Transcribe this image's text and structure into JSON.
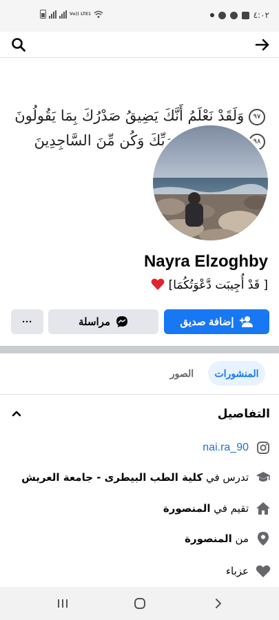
{
  "status_bar": {
    "network_label": "Vo)) LTE1",
    "time": "٤:٠٢"
  },
  "nav": {
    "back_icon": "arrow-right-icon",
    "search_icon": "search-icon"
  },
  "cover": {
    "line1": "وَلَقَدْ نَعْلَمُ أَنَّكَ يَضِيقُ صَدْرُكَ بِمَا يَقُولُونَ",
    "ayah1": "٩٧",
    "line2": "فَسَبِّحْ بِحَمْدِ رَبِّكَ وَكُن مِّنَ السَّاجِدِينَ",
    "ayah2": "٩٨"
  },
  "profile": {
    "name": "Nayra Elzoghby",
    "bio": "[ قَدْ أُجِيبَت دَّعْوَتُكُمَا]"
  },
  "actions": {
    "add_friend": "إضافة صديق",
    "message": "مراسلة",
    "more": "···"
  },
  "tabs": {
    "posts": "المنشورات",
    "photos": "الصور"
  },
  "details": {
    "title": "التفاصيل",
    "instagram": "nai.ra_90",
    "studies_prefix": "تدرس في ",
    "studies": "كلية الطب البيطرى - جامعة العريش",
    "lives_prefix": "تقيم في ",
    "lives": "المنصورة",
    "from_prefix": "من ",
    "from": "المنصورة",
    "relationship": "عزباء"
  },
  "colors": {
    "accent": "#1877f2",
    "link": "#216fdb",
    "heart": "#e0232f"
  }
}
